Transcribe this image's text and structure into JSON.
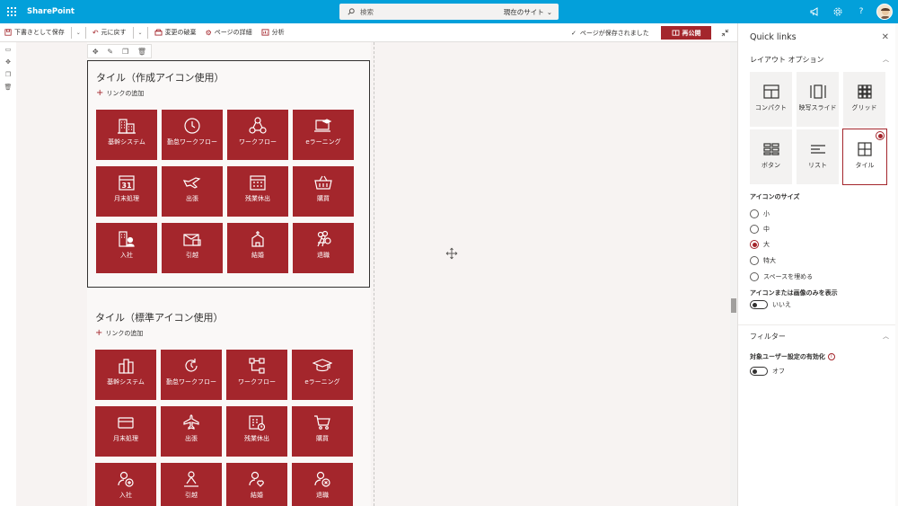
{
  "suite": {
    "brand": "SharePoint",
    "search_placeholder": "検索",
    "search_scope": "現在のサイト"
  },
  "command_bar": {
    "save_draft": "下書きとして保存",
    "undo": "元に戻す",
    "discard": "変更の破棄",
    "page_details": "ページの詳細",
    "analytics": "分析",
    "saved_status": "ページが保存されました",
    "republish": "再公開"
  },
  "webpart1": {
    "title": "タイル（作成アイコン使用）",
    "add_link": "リンクの追加",
    "tiles": [
      "基幹システム",
      "勤怠ワークフロー",
      "ワークフロー",
      "eラーニング",
      "月末処理",
      "出張",
      "残業休出",
      "購買",
      "入社",
      "引越",
      "結婚",
      "退職"
    ],
    "calendar_day": "31"
  },
  "webpart2": {
    "title": "タイル（標準アイコン使用）",
    "add_link": "リンクの追加",
    "tiles": [
      "基幹システム",
      "勤怠ワークフロー",
      "ワークフロー",
      "eラーニング",
      "月末処理",
      "出張",
      "残業休出",
      "購買",
      "入社",
      "引越",
      "結婚",
      "退職"
    ]
  },
  "pane": {
    "title": "Quick links",
    "layout_group": "レイアウト オプション",
    "layouts": [
      "コンパクト",
      "映写スライド",
      "グリッド",
      "ボタン",
      "リスト",
      "タイル"
    ],
    "selected_layout": "タイル",
    "icon_size_label": "アイコンのサイズ",
    "icon_sizes": [
      "小",
      "中",
      "大",
      "特大",
      "スペースを埋める"
    ],
    "selected_icon_size": "大",
    "icon_only_label": "アイコンまたは画像のみを表示",
    "icon_only_value": "いいえ",
    "filter_group": "フィルター",
    "audience_label": "対象ユーザー設定の有効化",
    "audience_value": "オフ"
  },
  "colors": {
    "suite": "#03a0da",
    "accent": "#a4262c"
  }
}
